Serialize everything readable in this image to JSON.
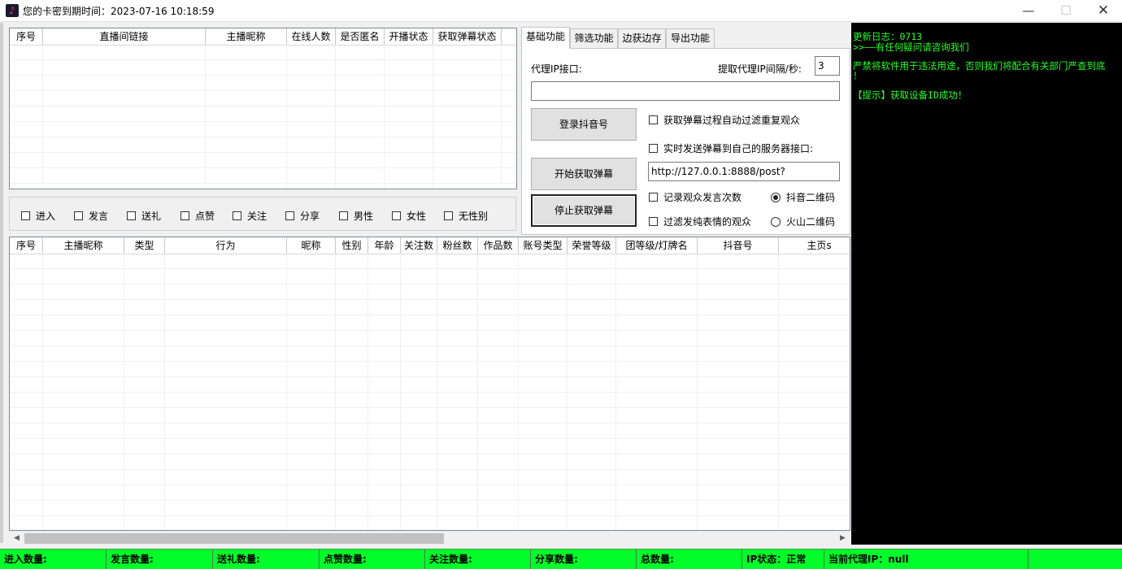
{
  "window": {
    "title": "您的卡密到期时间：2023-07-16 10:18:59",
    "icon": "douyin-logo-icon",
    "minimize": "—",
    "maximize": "☐",
    "close": "✕"
  },
  "room_grid": {
    "columns": [
      "序号",
      "直播间链接",
      "主播昵称",
      "在线人数",
      "是否匿名",
      "开播状态",
      "获取弹幕状态"
    ]
  },
  "filters": [
    {
      "label": "进入",
      "checked": false
    },
    {
      "label": "发言",
      "checked": false
    },
    {
      "label": "送礼",
      "checked": false
    },
    {
      "label": "点赞",
      "checked": false
    },
    {
      "label": "关注",
      "checked": false
    },
    {
      "label": "分享",
      "checked": false
    },
    {
      "label": "男性",
      "checked": false
    },
    {
      "label": "女性",
      "checked": false
    },
    {
      "label": "无性别",
      "checked": false
    }
  ],
  "tabs": [
    {
      "label": "基础功能",
      "active": true
    },
    {
      "label": "筛选功能",
      "active": false
    },
    {
      "label": "边获边存",
      "active": false
    },
    {
      "label": "导出功能",
      "active": false
    }
  ],
  "basic": {
    "proxy_label": "代理IP接口:",
    "proxy_value": "",
    "interval_label": "提取代理IP间隔/秒:",
    "interval_value": "3",
    "login_button": "登录抖音号",
    "start_button": "开始获取弹幕",
    "stop_button": "停止获取弹幕",
    "opt_dedupe": "获取弹幕过程自动过滤重复观众",
    "opt_send_server": "实时发送弹幕到自己的服务器接口:",
    "server_url": "http://127.0.0.1:8888/post?",
    "opt_record_count": "记录观众发言次数",
    "opt_filter_emoji": "过滤发纯表情的观众",
    "radio_douyin": "抖音二维码",
    "radio_huoshan": "火山二维码",
    "radio_selected": "douyin"
  },
  "danmu_grid": {
    "columns": [
      "序号",
      "主播昵称",
      "类型",
      "行为",
      "昵称",
      "性别",
      "年龄",
      "关注数",
      "粉丝数",
      "作品数",
      "账号类型",
      "荣誉等级",
      "团等级/灯牌名",
      "抖音号",
      "主页s"
    ]
  },
  "scrollbar": {
    "left_arrow": "◀",
    "right_arrow": "▶"
  },
  "log": {
    "lines": [
      "更新日志：0713",
      ">>——有任何疑问请咨询我们",
      "",
      "严禁将软件用于违法用途，否则我们将配合有关部门严查到底",
      "！",
      "",
      "【提示】获取设备ID成功！"
    ],
    "text_color": "#29ff29",
    "background": "#000000"
  },
  "status": {
    "enter_count": "进入数量:",
    "speak_count": "发言数量:",
    "gift_count": "送礼数量:",
    "like_count": "点赞数量:",
    "follow_count": "关注数量:",
    "share_count": "分享数量:",
    "total_count": "总数量:",
    "ip_status": "IP状态：正常",
    "current_proxy": "当前代理IP：null",
    "bar_color": "#00ff2a"
  }
}
